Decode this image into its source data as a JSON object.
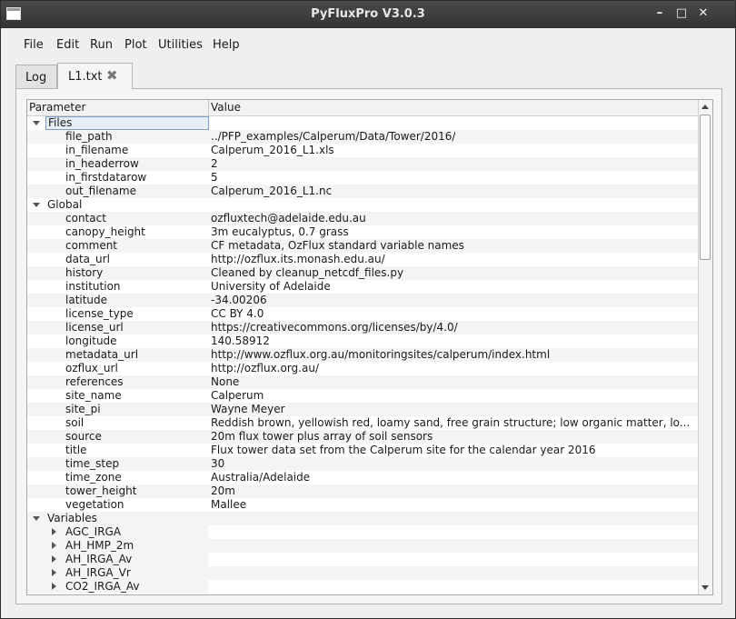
{
  "window": {
    "title": "PyFluxPro V3.0.3",
    "minimize": "–",
    "maximize": "□",
    "close": "✕"
  },
  "menu": [
    "File",
    "Edit",
    "Run",
    "Plot",
    "Utilities",
    "Help"
  ],
  "tabs": [
    {
      "label": "Log"
    },
    {
      "label": "L1.txt",
      "close": "✖"
    }
  ],
  "columns": {
    "parameter": "Parameter",
    "value": "Value"
  },
  "rows": [
    {
      "kind": "section",
      "name": "Files",
      "expanded": true,
      "selected": true
    },
    {
      "kind": "item",
      "name": "file_path",
      "value": "../PFP_examples/Calperum/Data/Tower/2016/"
    },
    {
      "kind": "item",
      "name": "in_filename",
      "value": "Calperum_2016_L1.xls"
    },
    {
      "kind": "item",
      "name": "in_headerrow",
      "value": "2"
    },
    {
      "kind": "item",
      "name": "in_firstdatarow",
      "value": "5"
    },
    {
      "kind": "item",
      "name": "out_filename",
      "value": "Calperum_2016_L1.nc"
    },
    {
      "kind": "section",
      "name": "Global",
      "expanded": true
    },
    {
      "kind": "item",
      "name": "contact",
      "value": "ozfluxtech@adelaide.edu.au"
    },
    {
      "kind": "item",
      "name": "canopy_height",
      "value": "3m eucalyptus, 0.7 grass"
    },
    {
      "kind": "item",
      "name": "comment",
      "value": "CF metadata, OzFlux standard variable names"
    },
    {
      "kind": "item",
      "name": "data_url",
      "value": "http://ozflux.its.monash.edu.au/"
    },
    {
      "kind": "item",
      "name": "history",
      "value": "Cleaned by cleanup_netcdf_files.py"
    },
    {
      "kind": "item",
      "name": "institution",
      "value": "University of Adelaide"
    },
    {
      "kind": "item",
      "name": "latitude",
      "value": "-34.00206"
    },
    {
      "kind": "item",
      "name": "license_type",
      "value": "CC BY 4.0"
    },
    {
      "kind": "item",
      "name": "license_url",
      "value": "https://creativecommons.org/licenses/by/4.0/"
    },
    {
      "kind": "item",
      "name": "longitude",
      "value": "140.58912"
    },
    {
      "kind": "item",
      "name": "metadata_url",
      "value": "http://www.ozflux.org.au/monitoringsites/calperum/index.html"
    },
    {
      "kind": "item",
      "name": "ozflux_url",
      "value": "http://ozflux.org.au/"
    },
    {
      "kind": "item",
      "name": "references",
      "value": "None"
    },
    {
      "kind": "item",
      "name": "site_name",
      "value": "Calperum"
    },
    {
      "kind": "item",
      "name": "site_pi",
      "value": "Wayne Meyer"
    },
    {
      "kind": "item",
      "name": "soil",
      "value": "Reddish brown, yellowish red, loamy sand, free grain structure; low organic matter, lo..."
    },
    {
      "kind": "item",
      "name": "source",
      "value": "20m flux tower plus array of soil sensors"
    },
    {
      "kind": "item",
      "name": "title",
      "value": "Flux tower data set from the Calperum site for the calendar year 2016"
    },
    {
      "kind": "item",
      "name": "time_step",
      "value": "30"
    },
    {
      "kind": "item",
      "name": "time_zone",
      "value": "Australia/Adelaide"
    },
    {
      "kind": "item",
      "name": "tower_height",
      "value": "20m"
    },
    {
      "kind": "item",
      "name": "vegetation",
      "value": "Mallee"
    },
    {
      "kind": "section",
      "name": "Variables",
      "expanded": true
    },
    {
      "kind": "var",
      "name": "AGC_IRGA"
    },
    {
      "kind": "var",
      "name": "AH_HMP_2m"
    },
    {
      "kind": "var",
      "name": "AH_IRGA_Av"
    },
    {
      "kind": "var",
      "name": "AH_IRGA_Vr"
    },
    {
      "kind": "var",
      "name": "CO2_IRGA_Av"
    }
  ]
}
